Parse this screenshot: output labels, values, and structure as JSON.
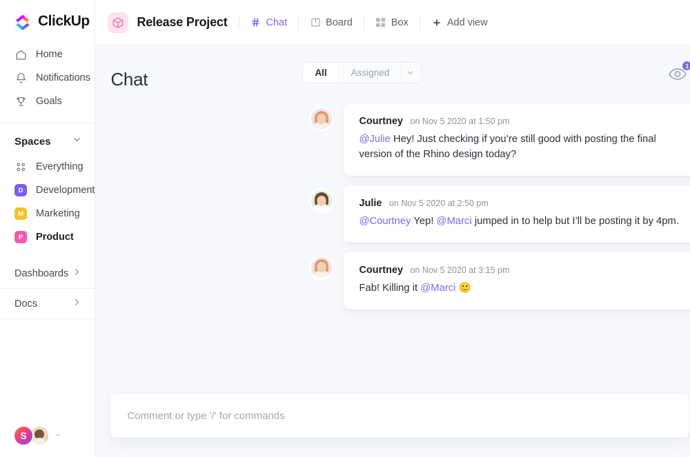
{
  "brand": {
    "name": "ClickUp",
    "logo_icon": "clickup-logo-icon"
  },
  "sidebar": {
    "nav": [
      {
        "label": "Home",
        "icon": "home-icon"
      },
      {
        "label": "Notifications",
        "icon": "bell-icon"
      },
      {
        "label": "Goals",
        "icon": "trophy-icon"
      }
    ],
    "spaces_section": {
      "title": "Spaces",
      "caret_icon": "chevron-down-icon"
    },
    "spaces": [
      {
        "label": "Everything",
        "icon": "grid-dots-icon",
        "badge": "",
        "color": "",
        "active": false
      },
      {
        "label": "Development",
        "icon": "space-badge",
        "badge": "D",
        "color": "#7b5cf0",
        "active": false
      },
      {
        "label": "Marketing",
        "icon": "space-badge",
        "badge": "M",
        "color": "#f6c026",
        "active": false
      },
      {
        "label": "Product",
        "icon": "space-badge",
        "badge": "P",
        "color": "#f35ba6",
        "active": true
      }
    ],
    "collapsibles": [
      {
        "label": "Dashboards",
        "caret_icon": "chevron-right-icon"
      },
      {
        "label": "Docs",
        "caret_icon": "chevron-right-icon"
      }
    ],
    "footer": {
      "avatar_initial": "S",
      "avatar_photo_name": "user-photo-avatar",
      "caret_icon": "chevron-down-icon"
    }
  },
  "topbar": {
    "project_icon": "cube-icon",
    "project_title": "Release Project",
    "tabs": [
      {
        "label": "Chat",
        "icon": "hash-icon",
        "active": true
      },
      {
        "label": "Board",
        "icon": "board-icon",
        "active": false
      },
      {
        "label": "Box",
        "icon": "box-grid-icon",
        "active": false
      }
    ],
    "add_view": {
      "label": "Add view",
      "icon": "plus-icon"
    }
  },
  "content": {
    "page_title": "Chat",
    "filter": {
      "all_label": "All",
      "assigned_label": "Assigned",
      "caret_icon": "chevron-down-icon",
      "selected": "All"
    },
    "watchers": {
      "icon": "eye-icon",
      "count": "1"
    }
  },
  "messages": [
    {
      "author": "Courtney",
      "time": "on Nov 5 2020 at 1:50 pm",
      "avatar": "courtney-avatar",
      "parts": [
        {
          "type": "mention",
          "text": "@Julie"
        },
        {
          "type": "text",
          "text": " Hey! Just checking if you’re still good with posting the final version of the Rhino design today?"
        }
      ]
    },
    {
      "author": "Julie",
      "time": "on Nov 5 2020 at 2:50 pm",
      "avatar": "julie-avatar",
      "parts": [
        {
          "type": "mention",
          "text": "@Courtney"
        },
        {
          "type": "text",
          "text": " Yep! "
        },
        {
          "type": "mention",
          "text": "@Marci"
        },
        {
          "type": "text",
          "text": " jumped in to help but I’ll be posting it by 4pm."
        }
      ]
    },
    {
      "author": "Courtney",
      "time": "on Nov 5 2020 at 3:15 pm",
      "avatar": "courtney-avatar",
      "parts": [
        {
          "type": "text",
          "text": "Fab! Killing it "
        },
        {
          "type": "mention",
          "text": "@Marci"
        },
        {
          "type": "text",
          "text": " 🙂"
        }
      ]
    }
  ],
  "composer": {
    "placeholder": "Comment or type '/' for commands"
  },
  "colors": {
    "accent_purple": "#7b68ee",
    "canvas": "#f7f8fb",
    "pink_project": "#f35ba6"
  }
}
